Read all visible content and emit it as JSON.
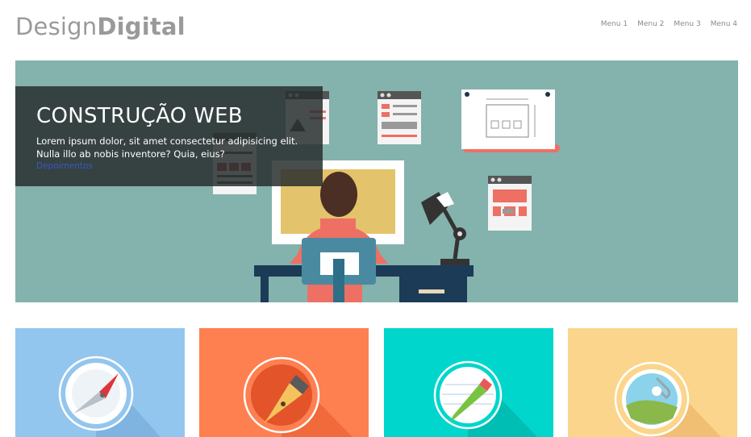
{
  "header": {
    "logo_light": "Design",
    "logo_bold": "Digital",
    "menu": [
      "Menu 1",
      "Menu 2",
      "Menu 3",
      "Menu 4"
    ]
  },
  "hero": {
    "title": "CONSTRUÇÃO WEB",
    "text": "Lorem ipsum dolor, sit amet consectetur adipisicing elit. Nulla illo ab nobis inventore? Quia, eius?",
    "link": "Depoimentos",
    "background": "#84b2ad"
  },
  "cards": [
    {
      "icon": "compass-icon",
      "color": "#93c6ee"
    },
    {
      "icon": "pen-nib-icon",
      "color": "#fe7f4f"
    },
    {
      "icon": "pencil-icon",
      "color": "#00d6cc"
    },
    {
      "icon": "paperclip-image-icon",
      "color": "#fbd58c"
    }
  ]
}
